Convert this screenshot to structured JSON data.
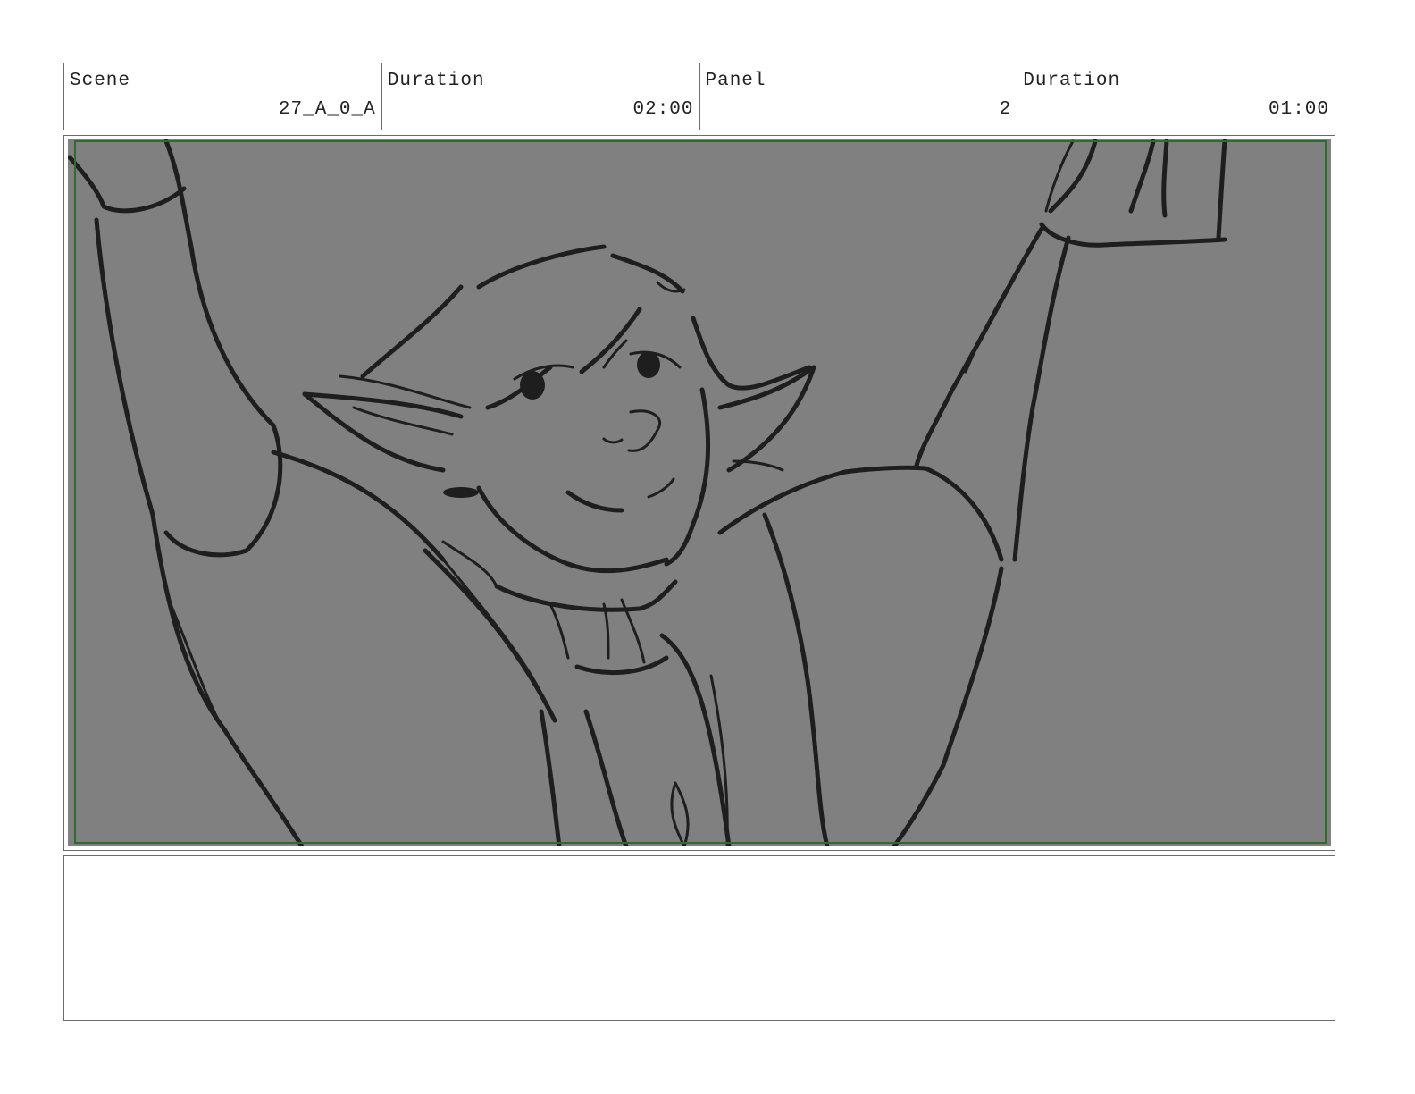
{
  "header": {
    "scene_label": "Scene",
    "scene_value": "27_A_0_A",
    "scene_duration_label": "Duration",
    "scene_duration_value": "02:00",
    "panel_label": "Panel",
    "panel_value": "2",
    "panel_duration_label": "Duration",
    "panel_duration_value": "01:00"
  },
  "panel": {
    "background_color": "#808080",
    "safe_frame_color": "#2f6b2f",
    "line_color": "#1e1e1e"
  },
  "notes": {
    "text": ""
  }
}
